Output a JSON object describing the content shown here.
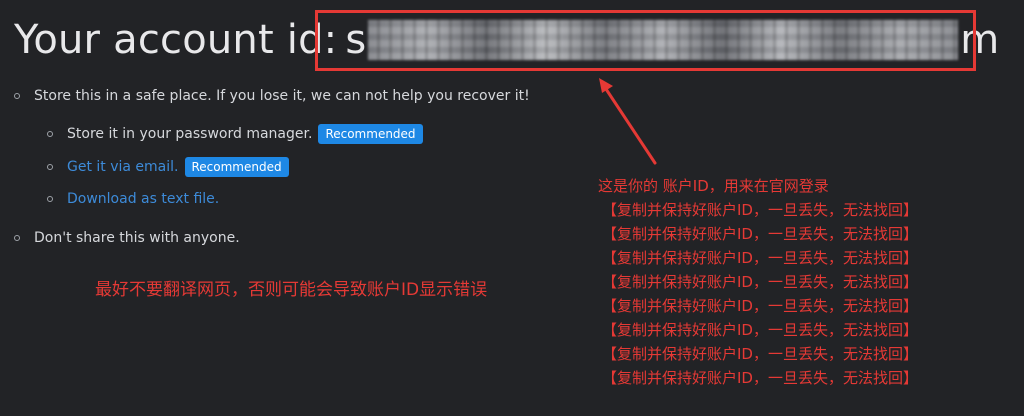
{
  "title": {
    "prefix": "Your account id:",
    "id_first_char": "s",
    "id_last_char": "m"
  },
  "bullets": {
    "store_safe": "Store this in a safe place. If you lose it, we can not help you recover it!",
    "password_manager": "Store it in your password manager.",
    "email_link": "Get it via email.",
    "download_link": "Download as text file.",
    "recommended_badge": "Recommended",
    "dont_share": "Don't share this with anyone."
  },
  "annotations": {
    "left_note": "最好不要翻译网页，否则可能会导致账户ID显示错误",
    "right_headline": "这是你的 账户ID，用来在官网登录",
    "right_repeat_lines": [
      "【复制并保持好账户ID，一旦丢失，无法找回】",
      "【复制并保持好账户ID，一旦丢失，无法找回】",
      "【复制并保持好账户ID，一旦丢失，无法找回】",
      "【复制并保持好账户ID，一旦丢失，无法找回】",
      "【复制并保持好账户ID，一旦丢失，无法找回】",
      "【复制并保持好账户ID，一旦丢失，无法找回】",
      "【复制并保持好账户ID，一旦丢失，无法找回】",
      "【复制并保持好账户ID，一旦丢失，无法找回】"
    ],
    "color": "#e53935"
  },
  "colors": {
    "background": "#222326",
    "text": "#d6d8dc",
    "link": "#3d8bd9",
    "badge": "#1e88e5",
    "highlight": "#e53935"
  }
}
